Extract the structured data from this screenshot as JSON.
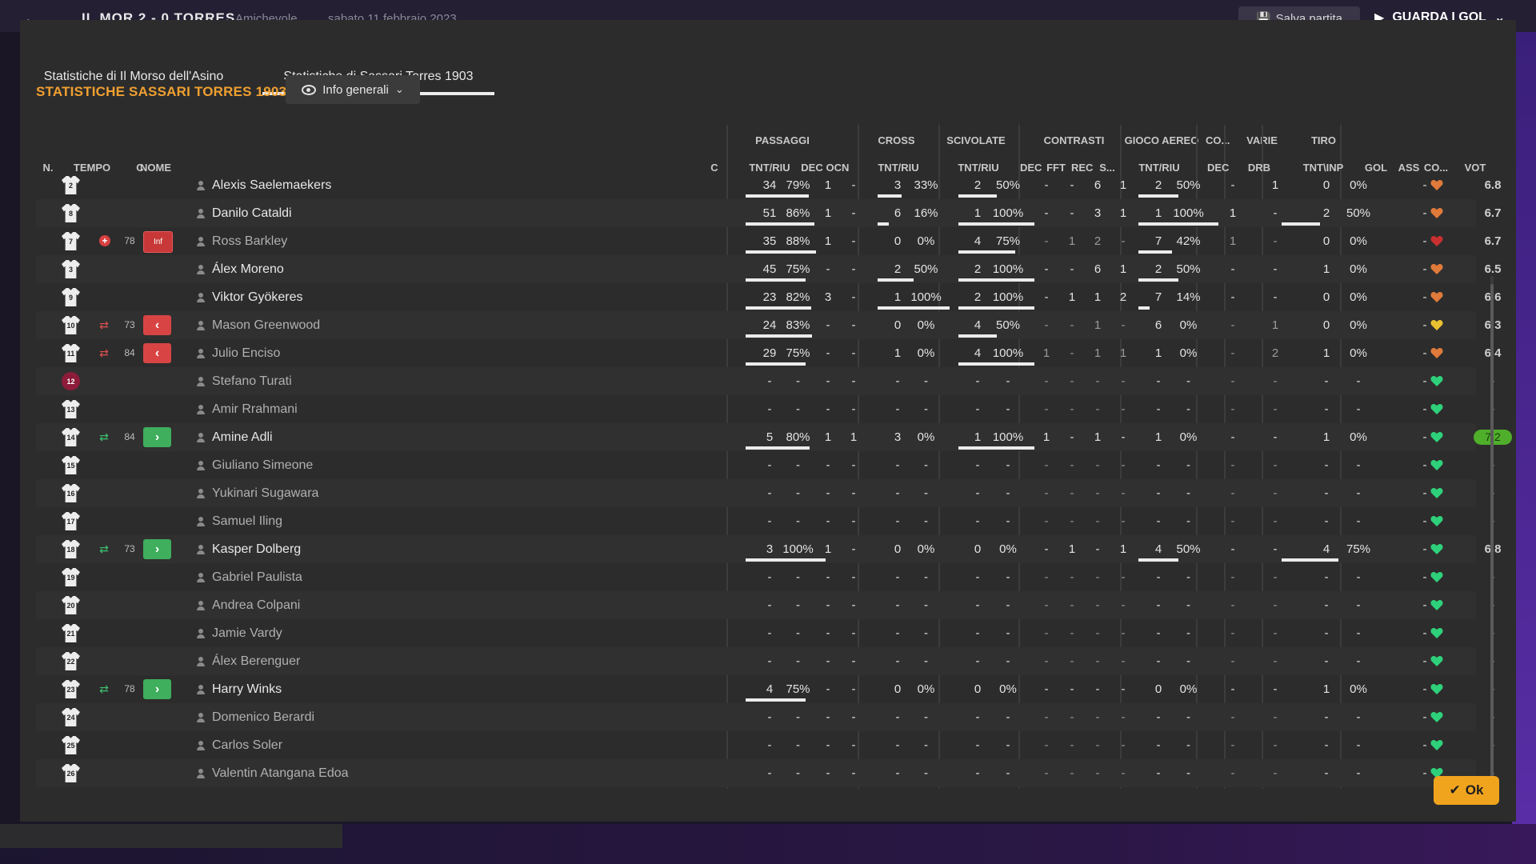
{
  "app": {
    "score": "IL MOR  2 - 0  TORRES",
    "match_type": "Amichevole",
    "date": "sabato 11 febbraio 2023",
    "save_label": "Salva partita",
    "goals_label": "GUARDA I GOL"
  },
  "tabs": [
    "Statistiche di Il Morso dell'Asino",
    "Statistiche di Sassari Torres 1903"
  ],
  "section_title": "STATISTICHE SASSARI TORRES 1903",
  "dropdown_label": "Info generali",
  "group_headers": {
    "passaggi": "PASSAGGI",
    "cross": "CROSS",
    "scivolate": "SCIVOLATE",
    "contrasti": "CONTRASTI",
    "gioco_aereo": "GIOCO AEREO",
    "co": "CO...",
    "varie": "VARIE",
    "tiro": "TIRO"
  },
  "column_headers": {
    "n": "N.",
    "tempo": "TEMPO",
    "c": "C",
    "nome": "NOME",
    "c2": "C",
    "pass_tnt": "TNT/RIU",
    "pass_dec": "DEC",
    "pass_ocn": "OCN",
    "cross_tnt": "TNT/RIU",
    "sciv_tnt": "TNT/RIU",
    "con_dec": "DEC",
    "con_fft": "FFT",
    "con_rec": "REC",
    "con_s": "S...",
    "aereo_tnt": "TNT/RIU",
    "co_dec": "DEC",
    "varie_drb": "DRB",
    "tiro_tnt": "TNT\\INP",
    "gol": "GOL",
    "ass": "ASS",
    "co2": "CO...",
    "vot": "VOT"
  },
  "players": [
    {
      "num": "2",
      "gk": false,
      "sub": "",
      "min": "",
      "cbox": "",
      "name": "Alexis Saelemaekers",
      "dim": false,
      "pass": [
        "34",
        "79%"
      ],
      "pass_fill": 0.79,
      "pdec": "1",
      "pocn": "-",
      "cross": [
        "3",
        "33%"
      ],
      "cross_fill": 0.33,
      "sciv": [
        "2",
        "50%"
      ],
      "sciv_fill": 0.5,
      "con": [
        "-",
        "-",
        "6",
        "1"
      ],
      "aereo": [
        "2",
        "50%"
      ],
      "aereo_fill": 0.5,
      "codec": "-",
      "drb": "1",
      "tiro": [
        "0",
        "0%"
      ],
      "tiro_fill": 0,
      "gol": "",
      "ass": "-",
      "mood": "orange",
      "vote": "6.8",
      "vote_style": "normal"
    },
    {
      "num": "8",
      "gk": false,
      "sub": "",
      "min": "",
      "cbox": "",
      "name": "Danilo Cataldi",
      "dim": false,
      "pass": [
        "51",
        "86%"
      ],
      "pass_fill": 0.86,
      "pdec": "1",
      "pocn": "-",
      "cross": [
        "6",
        "16%"
      ],
      "cross_fill": 0.16,
      "sciv": [
        "1",
        "100%"
      ],
      "sciv_fill": 1,
      "con": [
        "-",
        "-",
        "3",
        "1"
      ],
      "aereo": [
        "1",
        "100%"
      ],
      "aereo_fill": 1,
      "codec": "1",
      "drb": "-",
      "tiro": [
        "2",
        "50%"
      ],
      "tiro_fill": 0.5,
      "gol": "",
      "ass": "-",
      "mood": "orange",
      "vote": "6.7",
      "vote_style": "normal"
    },
    {
      "num": "7",
      "gk": false,
      "sub": "injury",
      "min": "78",
      "cbox": "Inf",
      "name": "Ross Barkley",
      "dim": true,
      "pass": [
        "35",
        "88%"
      ],
      "pass_fill": 0.88,
      "pdec": "1",
      "pocn": "-",
      "cross": [
        "0",
        "0%"
      ],
      "cross_fill": 0,
      "sciv": [
        "4",
        "75%"
      ],
      "sciv_fill": 0.75,
      "con": [
        "-",
        "1",
        "2",
        "-"
      ],
      "aereo": [
        "7",
        "42%"
      ],
      "aereo_fill": 0.42,
      "codec": "1",
      "drb": "-",
      "tiro": [
        "0",
        "0%"
      ],
      "tiro_fill": 0,
      "gol": "",
      "ass": "-",
      "mood": "red",
      "vote": "6.7",
      "vote_style": "normal"
    },
    {
      "num": "3",
      "gk": false,
      "sub": "",
      "min": "",
      "cbox": "",
      "name": "Álex Moreno",
      "dim": false,
      "pass": [
        "45",
        "75%"
      ],
      "pass_fill": 0.75,
      "pdec": "-",
      "pocn": "-",
      "cross": [
        "2",
        "50%"
      ],
      "cross_fill": 0.5,
      "sciv": [
        "2",
        "100%"
      ],
      "sciv_fill": 1,
      "con": [
        "-",
        "-",
        "6",
        "1"
      ],
      "aereo": [
        "2",
        "50%"
      ],
      "aereo_fill": 0.5,
      "codec": "-",
      "drb": "-",
      "tiro": [
        "1",
        "0%"
      ],
      "tiro_fill": 0,
      "gol": "",
      "ass": "-",
      "mood": "orange",
      "vote": "6.5",
      "vote_style": "normal"
    },
    {
      "num": "9",
      "gk": false,
      "sub": "",
      "min": "",
      "cbox": "",
      "name": "Viktor Gyökeres",
      "dim": false,
      "pass": [
        "23",
        "82%"
      ],
      "pass_fill": 0.82,
      "pdec": "3",
      "pocn": "-",
      "cross": [
        "1",
        "100%"
      ],
      "cross_fill": 1,
      "sciv": [
        "2",
        "100%"
      ],
      "sciv_fill": 1,
      "con": [
        "-",
        "1",
        "1",
        "2"
      ],
      "aereo": [
        "7",
        "14%"
      ],
      "aereo_fill": 0.14,
      "codec": "-",
      "drb": "-",
      "tiro": [
        "0",
        "0%"
      ],
      "tiro_fill": 0,
      "gol": "",
      "ass": "-",
      "mood": "orange",
      "vote": "6.6",
      "vote_style": "normal"
    },
    {
      "num": "10",
      "gk": false,
      "sub": "out",
      "min": "73",
      "cbox": "red",
      "name": "Mason Greenwood",
      "dim": true,
      "pass": [
        "24",
        "83%"
      ],
      "pass_fill": 0.83,
      "pdec": "-",
      "pocn": "-",
      "cross": [
        "0",
        "0%"
      ],
      "cross_fill": 0,
      "sciv": [
        "4",
        "50%"
      ],
      "sciv_fill": 0.5,
      "con": [
        "-",
        "-",
        "1",
        "-"
      ],
      "aereo": [
        "6",
        "0%"
      ],
      "aereo_fill": 0,
      "codec": "-",
      "drb": "1",
      "tiro": [
        "0",
        "0%"
      ],
      "tiro_fill": 0,
      "gol": "",
      "ass": "-",
      "mood": "yellow",
      "vote": "6.3",
      "vote_style": "normal"
    },
    {
      "num": "11",
      "gk": false,
      "sub": "out",
      "min": "84",
      "cbox": "red",
      "name": "Julio Enciso",
      "dim": true,
      "pass": [
        "29",
        "75%"
      ],
      "pass_fill": 0.75,
      "pdec": "-",
      "pocn": "-",
      "cross": [
        "1",
        "0%"
      ],
      "cross_fill": 0,
      "sciv": [
        "4",
        "100%"
      ],
      "sciv_fill": 1,
      "con": [
        "1",
        "-",
        "1",
        "1"
      ],
      "aereo": [
        "1",
        "0%"
      ],
      "aereo_fill": 0,
      "codec": "-",
      "drb": "2",
      "tiro": [
        "1",
        "0%"
      ],
      "tiro_fill": 0,
      "gol": "",
      "ass": "-",
      "mood": "orange",
      "vote": "6.4",
      "vote_style": "normal"
    },
    {
      "num": "12",
      "gk": true,
      "sub": "",
      "min": "",
      "cbox": "",
      "name": "Stefano Turati",
      "dim": true,
      "pass": [
        "-",
        "-"
      ],
      "pass_fill": 0,
      "pdec": "-",
      "pocn": "-",
      "cross": [
        "-",
        "-"
      ],
      "cross_fill": 0,
      "sciv": [
        "-",
        "-"
      ],
      "sciv_fill": 0,
      "con": [
        "-",
        "-",
        "-",
        "-"
      ],
      "aereo": [
        "-",
        "-"
      ],
      "aereo_fill": 0,
      "codec": "-",
      "drb": "-",
      "tiro": [
        "-",
        "-"
      ],
      "tiro_fill": 0,
      "gol": "",
      "ass": "-",
      "mood": "green",
      "vote": "-",
      "vote_style": "dim"
    },
    {
      "num": "13",
      "gk": false,
      "sub": "",
      "min": "",
      "cbox": "",
      "name": "Amir Rrahmani",
      "dim": true,
      "pass": [
        "-",
        "-"
      ],
      "pass_fill": 0,
      "pdec": "-",
      "pocn": "-",
      "cross": [
        "-",
        "-"
      ],
      "cross_fill": 0,
      "sciv": [
        "-",
        "-"
      ],
      "sciv_fill": 0,
      "con": [
        "-",
        "-",
        "-",
        "-"
      ],
      "aereo": [
        "-",
        "-"
      ],
      "aereo_fill": 0,
      "codec": "-",
      "drb": "-",
      "tiro": [
        "-",
        "-"
      ],
      "tiro_fill": 0,
      "gol": "",
      "ass": "-",
      "mood": "green",
      "vote": "-",
      "vote_style": "dim"
    },
    {
      "num": "14",
      "gk": false,
      "sub": "in",
      "min": "84",
      "cbox": "green",
      "name": "Amine Adli",
      "dim": false,
      "pass": [
        "5",
        "80%"
      ],
      "pass_fill": 0.8,
      "pdec": "1",
      "pocn": "1",
      "cross": [
        "3",
        "0%"
      ],
      "cross_fill": 0,
      "sciv": [
        "1",
        "100%"
      ],
      "sciv_fill": 1,
      "con": [
        "1",
        "-",
        "1",
        "-"
      ],
      "aereo": [
        "1",
        "0%"
      ],
      "aereo_fill": 0,
      "codec": "-",
      "drb": "-",
      "tiro": [
        "1",
        "0%"
      ],
      "tiro_fill": 0,
      "gol": "",
      "ass": "-",
      "mood": "green",
      "vote": "7.2",
      "vote_style": "hi"
    },
    {
      "num": "15",
      "gk": false,
      "sub": "",
      "min": "",
      "cbox": "",
      "name": "Giuliano Simeone",
      "dim": true,
      "pass": [
        "-",
        "-"
      ],
      "pass_fill": 0,
      "pdec": "-",
      "pocn": "-",
      "cross": [
        "-",
        "-"
      ],
      "cross_fill": 0,
      "sciv": [
        "-",
        "-"
      ],
      "sciv_fill": 0,
      "con": [
        "-",
        "-",
        "-",
        "-"
      ],
      "aereo": [
        "-",
        "-"
      ],
      "aereo_fill": 0,
      "codec": "-",
      "drb": "-",
      "tiro": [
        "-",
        "-"
      ],
      "tiro_fill": 0,
      "gol": "",
      "ass": "-",
      "mood": "green",
      "vote": "-",
      "vote_style": "dim"
    },
    {
      "num": "16",
      "gk": false,
      "sub": "",
      "min": "",
      "cbox": "",
      "name": "Yukinari Sugawara",
      "dim": true,
      "pass": [
        "-",
        "-"
      ],
      "pass_fill": 0,
      "pdec": "-",
      "pocn": "-",
      "cross": [
        "-",
        "-"
      ],
      "cross_fill": 0,
      "sciv": [
        "-",
        "-"
      ],
      "sciv_fill": 0,
      "con": [
        "-",
        "-",
        "-",
        "-"
      ],
      "aereo": [
        "-",
        "-"
      ],
      "aereo_fill": 0,
      "codec": "-",
      "drb": "-",
      "tiro": [
        "-",
        "-"
      ],
      "tiro_fill": 0,
      "gol": "",
      "ass": "-",
      "mood": "green",
      "vote": "-",
      "vote_style": "dim"
    },
    {
      "num": "17",
      "gk": false,
      "sub": "",
      "min": "",
      "cbox": "",
      "name": "Samuel Iling",
      "dim": true,
      "pass": [
        "-",
        "-"
      ],
      "pass_fill": 0,
      "pdec": "-",
      "pocn": "-",
      "cross": [
        "-",
        "-"
      ],
      "cross_fill": 0,
      "sciv": [
        "-",
        "-"
      ],
      "sciv_fill": 0,
      "con": [
        "-",
        "-",
        "-",
        "-"
      ],
      "aereo": [
        "-",
        "-"
      ],
      "aereo_fill": 0,
      "codec": "-",
      "drb": "-",
      "tiro": [
        "-",
        "-"
      ],
      "tiro_fill": 0,
      "gol": "",
      "ass": "-",
      "mood": "green",
      "vote": "-",
      "vote_style": "dim"
    },
    {
      "num": "18",
      "gk": false,
      "sub": "in",
      "min": "73",
      "cbox": "green",
      "name": "Kasper Dolberg",
      "dim": false,
      "pass": [
        "3",
        "100%"
      ],
      "pass_fill": 1,
      "pdec": "1",
      "pocn": "-",
      "cross": [
        "0",
        "0%"
      ],
      "cross_fill": 0,
      "sciv": [
        "0",
        "0%"
      ],
      "sciv_fill": 0,
      "con": [
        "-",
        "1",
        "-",
        "1"
      ],
      "aereo": [
        "4",
        "50%"
      ],
      "aereo_fill": 0.5,
      "codec": "-",
      "drb": "-",
      "tiro": [
        "4",
        "75%"
      ],
      "tiro_fill": 0.75,
      "gol": "",
      "ass": "-",
      "mood": "green",
      "vote": "6.8",
      "vote_style": "normal"
    },
    {
      "num": "19",
      "gk": false,
      "sub": "",
      "min": "",
      "cbox": "",
      "name": "Gabriel Paulista",
      "dim": true,
      "pass": [
        "-",
        "-"
      ],
      "pass_fill": 0,
      "pdec": "-",
      "pocn": "-",
      "cross": [
        "-",
        "-"
      ],
      "cross_fill": 0,
      "sciv": [
        "-",
        "-"
      ],
      "sciv_fill": 0,
      "con": [
        "-",
        "-",
        "-",
        "-"
      ],
      "aereo": [
        "-",
        "-"
      ],
      "aereo_fill": 0,
      "codec": "-",
      "drb": "-",
      "tiro": [
        "-",
        "-"
      ],
      "tiro_fill": 0,
      "gol": "",
      "ass": "-",
      "mood": "green",
      "vote": "-",
      "vote_style": "dim"
    },
    {
      "num": "20",
      "gk": false,
      "sub": "",
      "min": "",
      "cbox": "",
      "name": "Andrea Colpani",
      "dim": true,
      "pass": [
        "-",
        "-"
      ],
      "pass_fill": 0,
      "pdec": "-",
      "pocn": "-",
      "cross": [
        "-",
        "-"
      ],
      "cross_fill": 0,
      "sciv": [
        "-",
        "-"
      ],
      "sciv_fill": 0,
      "con": [
        "-",
        "-",
        "-",
        "-"
      ],
      "aereo": [
        "-",
        "-"
      ],
      "aereo_fill": 0,
      "codec": "-",
      "drb": "-",
      "tiro": [
        "-",
        "-"
      ],
      "tiro_fill": 0,
      "gol": "",
      "ass": "-",
      "mood": "green",
      "vote": "-",
      "vote_style": "dim"
    },
    {
      "num": "21",
      "gk": false,
      "sub": "",
      "min": "",
      "cbox": "",
      "name": "Jamie Vardy",
      "dim": true,
      "pass": [
        "-",
        "-"
      ],
      "pass_fill": 0,
      "pdec": "-",
      "pocn": "-",
      "cross": [
        "-",
        "-"
      ],
      "cross_fill": 0,
      "sciv": [
        "-",
        "-"
      ],
      "sciv_fill": 0,
      "con": [
        "-",
        "-",
        "-",
        "-"
      ],
      "aereo": [
        "-",
        "-"
      ],
      "aereo_fill": 0,
      "codec": "-",
      "drb": "-",
      "tiro": [
        "-",
        "-"
      ],
      "tiro_fill": 0,
      "gol": "",
      "ass": "-",
      "mood": "green",
      "vote": "-",
      "vote_style": "dim"
    },
    {
      "num": "22",
      "gk": false,
      "sub": "",
      "min": "",
      "cbox": "",
      "name": "Álex Berenguer",
      "dim": true,
      "pass": [
        "-",
        "-"
      ],
      "pass_fill": 0,
      "pdec": "-",
      "pocn": "-",
      "cross": [
        "-",
        "-"
      ],
      "cross_fill": 0,
      "sciv": [
        "-",
        "-"
      ],
      "sciv_fill": 0,
      "con": [
        "-",
        "-",
        "-",
        "-"
      ],
      "aereo": [
        "-",
        "-"
      ],
      "aereo_fill": 0,
      "codec": "-",
      "drb": "-",
      "tiro": [
        "-",
        "-"
      ],
      "tiro_fill": 0,
      "gol": "",
      "ass": "-",
      "mood": "green",
      "vote": "-",
      "vote_style": "dim"
    },
    {
      "num": "23",
      "gk": false,
      "sub": "in",
      "min": "78",
      "cbox": "green",
      "name": "Harry Winks",
      "dim": false,
      "pass": [
        "4",
        "75%"
      ],
      "pass_fill": 0.75,
      "pdec": "-",
      "pocn": "-",
      "cross": [
        "0",
        "0%"
      ],
      "cross_fill": 0,
      "sciv": [
        "0",
        "0%"
      ],
      "sciv_fill": 0,
      "con": [
        "-",
        "-",
        "-",
        "-"
      ],
      "aereo": [
        "0",
        "0%"
      ],
      "aereo_fill": 0,
      "codec": "-",
      "drb": "-",
      "tiro": [
        "1",
        "0%"
      ],
      "tiro_fill": 0,
      "gol": "",
      "ass": "-",
      "mood": "green",
      "vote": "-",
      "vote_style": "dim"
    },
    {
      "num": "24",
      "gk": false,
      "sub": "",
      "min": "",
      "cbox": "",
      "name": "Domenico Berardi",
      "dim": true,
      "pass": [
        "-",
        "-"
      ],
      "pass_fill": 0,
      "pdec": "-",
      "pocn": "-",
      "cross": [
        "-",
        "-"
      ],
      "cross_fill": 0,
      "sciv": [
        "-",
        "-"
      ],
      "sciv_fill": 0,
      "con": [
        "-",
        "-",
        "-",
        "-"
      ],
      "aereo": [
        "-",
        "-"
      ],
      "aereo_fill": 0,
      "codec": "-",
      "drb": "-",
      "tiro": [
        "-",
        "-"
      ],
      "tiro_fill": 0,
      "gol": "",
      "ass": "-",
      "mood": "green",
      "vote": "-",
      "vote_style": "dim"
    },
    {
      "num": "25",
      "gk": false,
      "sub": "",
      "min": "",
      "cbox": "",
      "name": "Carlos Soler",
      "dim": true,
      "pass": [
        "-",
        "-"
      ],
      "pass_fill": 0,
      "pdec": "-",
      "pocn": "-",
      "cross": [
        "-",
        "-"
      ],
      "cross_fill": 0,
      "sciv": [
        "-",
        "-"
      ],
      "sciv_fill": 0,
      "con": [
        "-",
        "-",
        "-",
        "-"
      ],
      "aereo": [
        "-",
        "-"
      ],
      "aereo_fill": 0,
      "codec": "-",
      "drb": "-",
      "tiro": [
        "-",
        "-"
      ],
      "tiro_fill": 0,
      "gol": "",
      "ass": "-",
      "mood": "green",
      "vote": "-",
      "vote_style": "dim"
    },
    {
      "num": "26",
      "gk": false,
      "sub": "",
      "min": "",
      "cbox": "",
      "name": "Valentin Atangana Edoa",
      "dim": true,
      "pass": [
        "-",
        "-"
      ],
      "pass_fill": 0,
      "pdec": "-",
      "pocn": "-",
      "cross": [
        "-",
        "-"
      ],
      "cross_fill": 0,
      "sciv": [
        "-",
        "-"
      ],
      "sciv_fill": 0,
      "con": [
        "-",
        "-",
        "-",
        "-"
      ],
      "aereo": [
        "-",
        "-"
      ],
      "aereo_fill": 0,
      "codec": "-",
      "drb": "-",
      "tiro": [
        "-",
        "-"
      ],
      "tiro_fill": 0,
      "gol": "",
      "ass": "-",
      "mood": "green",
      "vote": "-",
      "vote_style": "dim"
    }
  ],
  "mood_colors": {
    "orange": "#e07a3a",
    "yellow": "#e8c030",
    "red": "#c83030",
    "green": "#2fd07a"
  },
  "ok_label": "Ok"
}
